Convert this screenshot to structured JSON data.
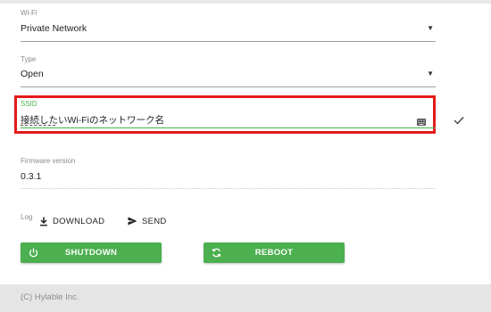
{
  "wifi": {
    "label": "Wi-Fi",
    "value": "Private Network"
  },
  "type": {
    "label": "Type",
    "value": "Open"
  },
  "ssid": {
    "label": "SSID",
    "value": "接続したいWi-Fiのネットワーク名"
  },
  "firmware": {
    "label": "Firmware version",
    "value": "0.3.1"
  },
  "log": {
    "label": "Log",
    "download_label": "DOWNLOAD",
    "send_label": "SEND"
  },
  "actions": {
    "shutdown_label": "SHUTDOWN",
    "reboot_label": "REBOOT"
  },
  "footer": {
    "copyright": "(C) Hylable Inc."
  },
  "colors": {
    "accent": "#4caf50",
    "highlight": "#e41a1a",
    "footer_bg": "#e5e5e5"
  },
  "icons": [
    "dropdown-caret-icon",
    "keyboard-icon",
    "checkmark-icon",
    "download-icon",
    "send-icon",
    "power-icon",
    "refresh-icon"
  ]
}
